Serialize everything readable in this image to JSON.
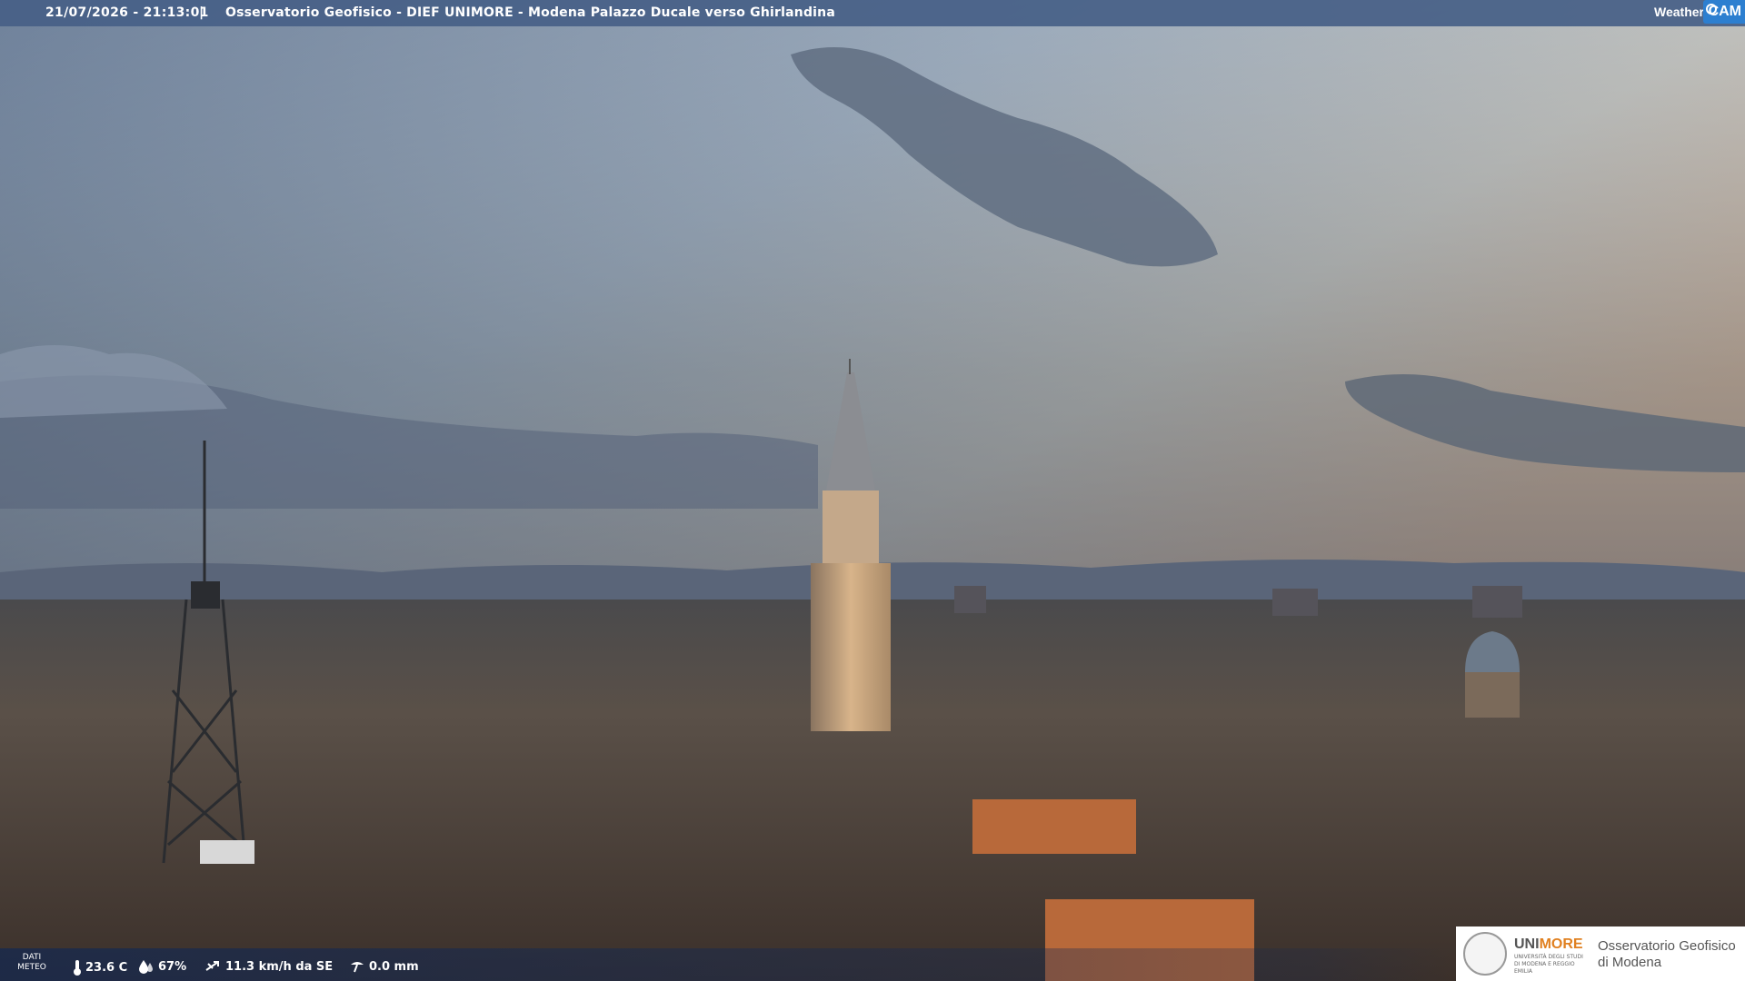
{
  "header": {
    "timestamp": "21/07/2026 - 21:13:01",
    "separator": "|",
    "title": "Osservatorio Geofisico - DIEF UNIMORE - Modena Palazzo Ducale verso Ghirlandina"
  },
  "brand": {
    "weather_text": "Weather",
    "cam_text": "CAM"
  },
  "weather": {
    "label_line1": "DATI",
    "label_line2": "METEO",
    "temperature": "23.6 C",
    "humidity": "67%",
    "wind": "11.3 km/h da SE",
    "rain": "0.0 mm"
  },
  "institution": {
    "name_a": "UNI",
    "name_b": "MORE",
    "subtitle": "UNIVERSITÀ DEGLI STUDI DI MODENA E REGGIO EMILIA",
    "observatory_line1": "Osservatorio Geofisico",
    "observatory_line2": "di Modena"
  },
  "colors": {
    "header_bg": "#465f87",
    "cam_blue": "#2d7fd0",
    "unimore_orange": "#e08020"
  }
}
